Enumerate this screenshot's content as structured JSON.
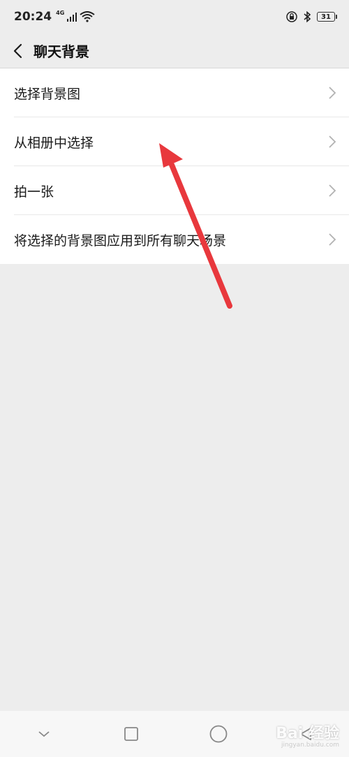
{
  "status_bar": {
    "time": "20:24",
    "network": "4G",
    "battery": "31"
  },
  "header": {
    "title": "聊天背景"
  },
  "menu": {
    "items": [
      {
        "label": "选择背景图"
      },
      {
        "label": "从相册中选择"
      },
      {
        "label": "拍一张"
      },
      {
        "label": "将选择的背景图应用到所有聊天场景"
      }
    ]
  },
  "watermark": {
    "main": "Bai 经验",
    "sub": "jingyan.baidu.com"
  },
  "colors": {
    "background": "#ededed",
    "card": "#ffffff",
    "arrow": "#e8383d"
  }
}
